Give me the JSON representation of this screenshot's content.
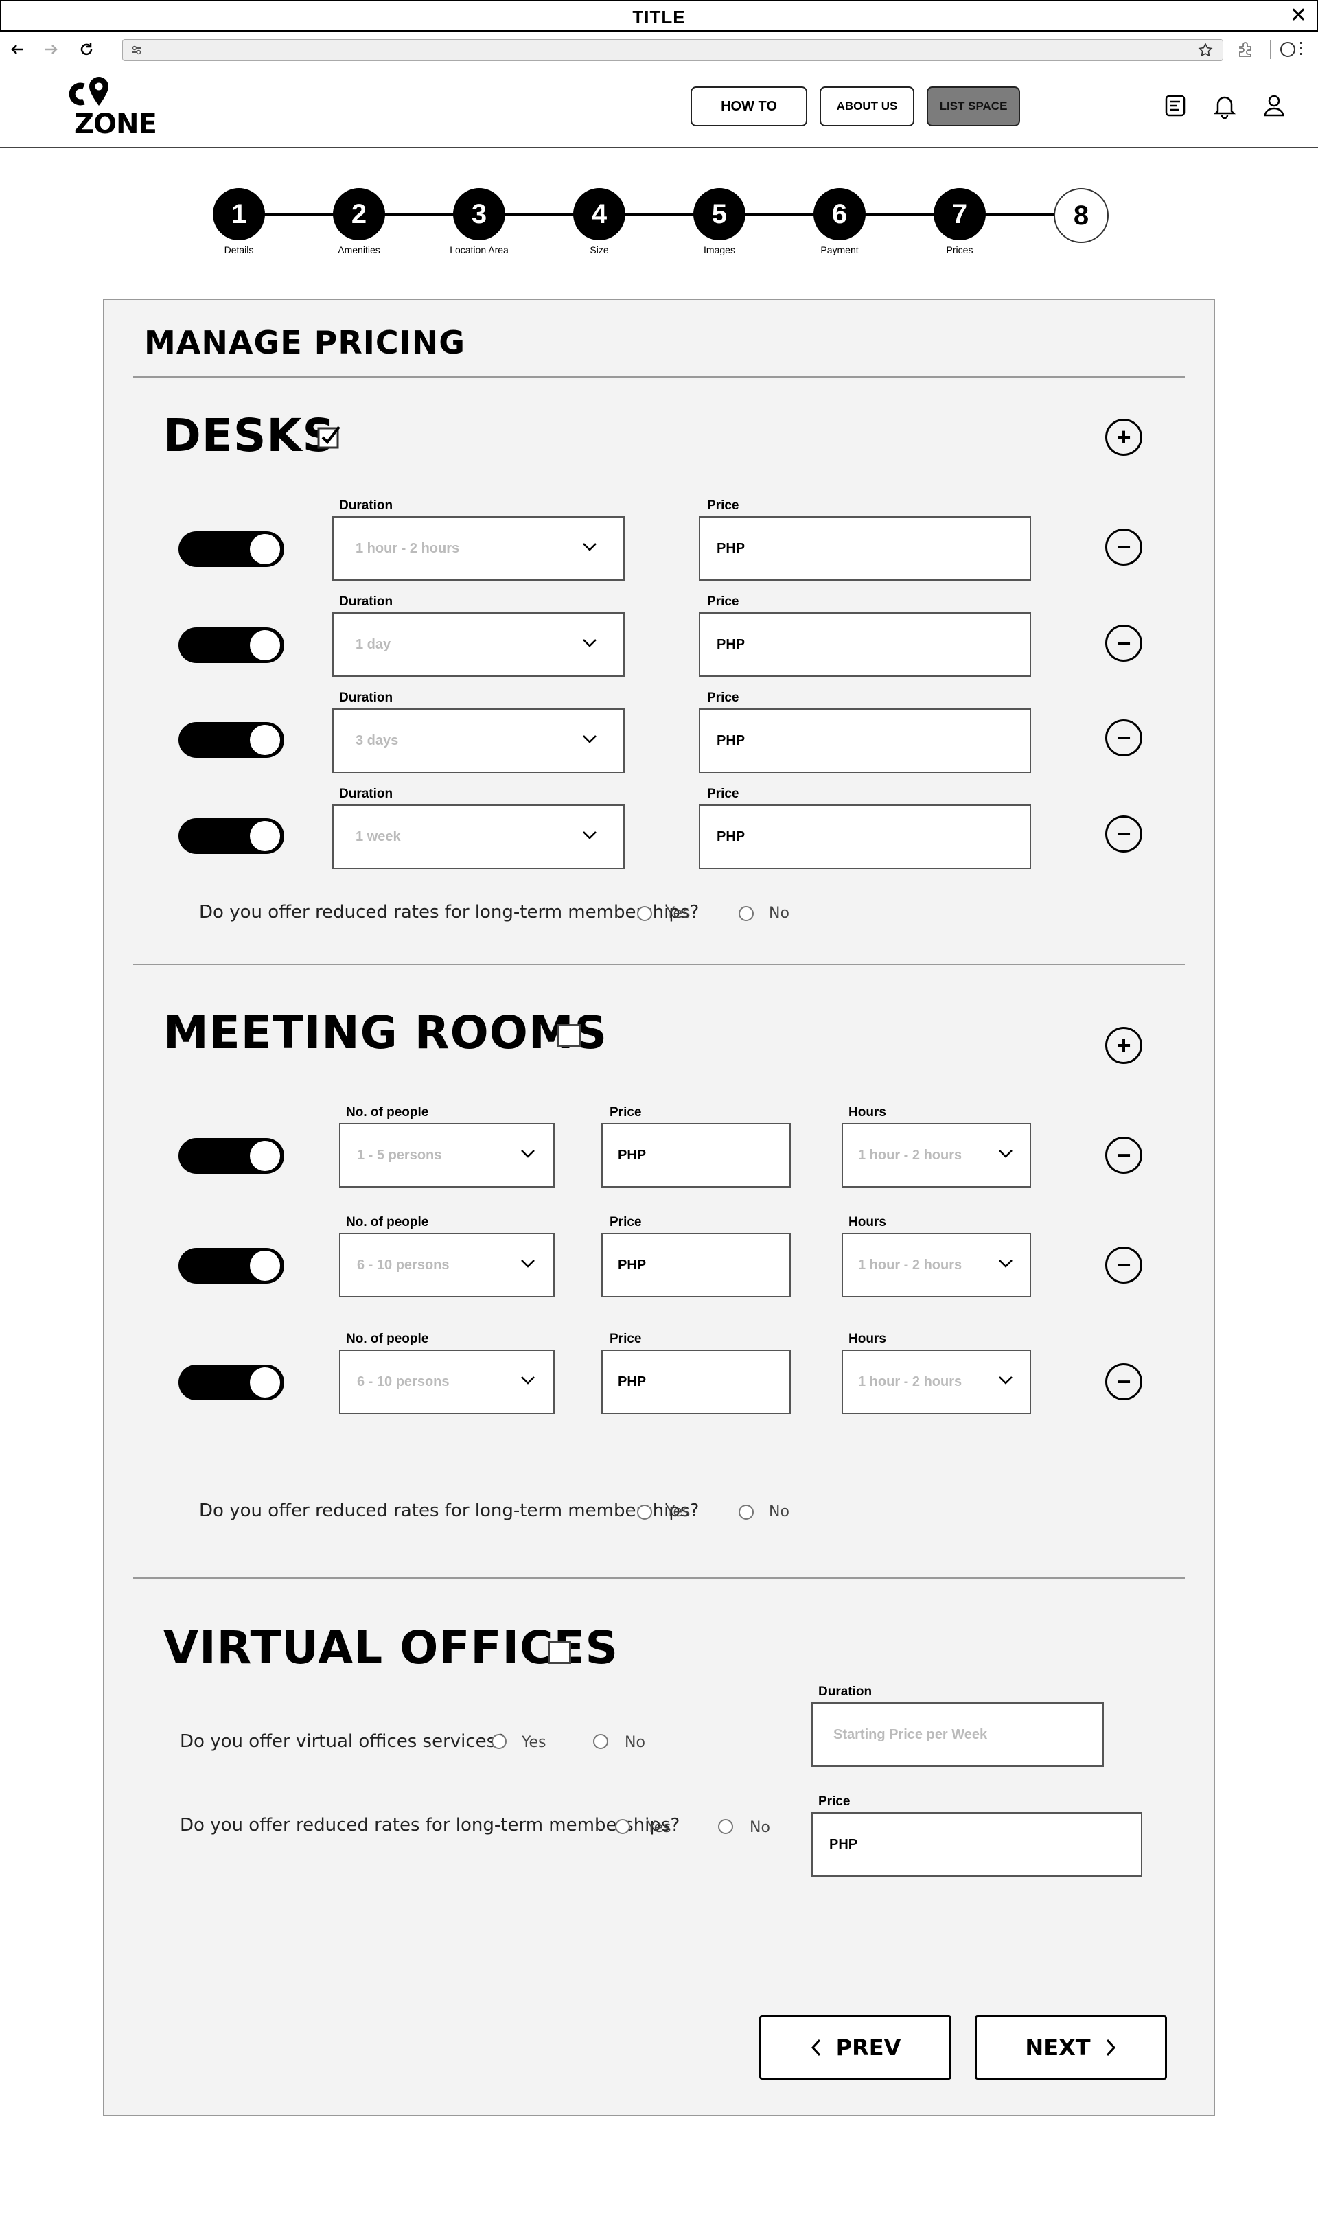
{
  "window": {
    "title": "TITLE"
  },
  "header": {
    "logo": "ZONE",
    "nav": [
      {
        "label": "HOW TO"
      },
      {
        "label": "ABOUT US"
      },
      {
        "label": "LIST SPACE",
        "active": true
      }
    ]
  },
  "stepper": {
    "steps": [
      {
        "number": "1",
        "label": "Details"
      },
      {
        "number": "2",
        "label": "Amenities"
      },
      {
        "number": "3",
        "label": "Location Area"
      },
      {
        "number": "4",
        "label": "Size"
      },
      {
        "number": "5",
        "label": "Images"
      },
      {
        "number": "6",
        "label": "Payment"
      },
      {
        "number": "7",
        "label": "Prices"
      },
      {
        "number": "8",
        "label": ""
      }
    ],
    "current_step": 8
  },
  "page": {
    "title": "MANAGE PRICING"
  },
  "desks": {
    "title": "DESKS",
    "checked": true,
    "rows": [
      {
        "duration_label": "Duration",
        "duration": "1 hour - 2 hours",
        "price_label": "Price",
        "price": "PHP",
        "enabled": true
      },
      {
        "duration_label": "Duration",
        "duration": "1 day",
        "price_label": "Price",
        "price": "PHP",
        "enabled": true
      },
      {
        "duration_label": "Duration",
        "duration": "3 days",
        "price_label": "Price",
        "price": "PHP",
        "enabled": true
      },
      {
        "duration_label": "Duration",
        "duration": "1 week",
        "price_label": "Price",
        "price": "PHP",
        "enabled": true
      }
    ],
    "question": "Do you offer reduced rates for long-term memberships?",
    "yes": "Yes",
    "no": "No"
  },
  "meeting_rooms": {
    "title": "MEETING ROOMS",
    "checked": false,
    "rows": [
      {
        "people_label": "No. of people",
        "people": "1 - 5 persons",
        "price_label": "Price",
        "price": "PHP",
        "hours_label": "Hours",
        "hours": "1 hour - 2 hours",
        "enabled": true
      },
      {
        "people_label": "No. of people",
        "people": "6 - 10 persons",
        "price_label": "Price",
        "price": "PHP",
        "hours_label": "Hours",
        "hours": "1 hour - 2 hours",
        "enabled": true
      },
      {
        "people_label": "No. of people",
        "people": "6 - 10 persons",
        "price_label": "Price",
        "price": "PHP",
        "hours_label": "Hours",
        "hours": "1 hour - 2 hours",
        "enabled": true
      }
    ],
    "question": "Do you offer reduced rates for long-term memberships?",
    "yes": "Yes",
    "no": "No"
  },
  "virtual_offices": {
    "title": "VIRTUAL OFFICES",
    "checked": false,
    "q1": "Do you offer virtual offices services?",
    "q2": "Do you offer reduced rates for long-term memberships?",
    "yes": "Yes",
    "no": "No",
    "duration_label": "Duration",
    "duration_placeholder": "Starting Price per Week",
    "price_label": "Price",
    "price": "PHP"
  },
  "footer": {
    "prev": "PREV",
    "next": "NEXT"
  }
}
